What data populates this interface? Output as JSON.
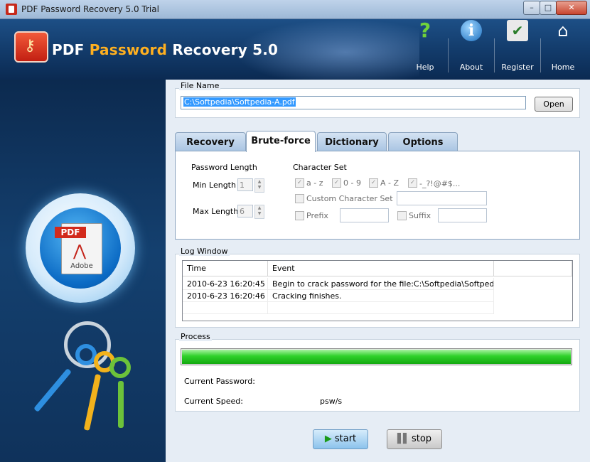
{
  "window": {
    "title": "PDF Password Recovery 5.0 Trial",
    "min": "–",
    "max": "□",
    "close": "✕"
  },
  "header": {
    "logo_text_1": "PDF",
    "logo_text_2": "Password",
    "logo_text_3": "Recovery 5.0",
    "nav": [
      {
        "label": "Help",
        "icon": "help-icon"
      },
      {
        "label": "About",
        "icon": "info-icon"
      },
      {
        "label": "Register",
        "icon": "register-icon"
      },
      {
        "label": "Home",
        "icon": "home-icon"
      }
    ]
  },
  "sidebar_art": {
    "pdf_tag": "PDF",
    "pdf_caption": "Adobe"
  },
  "file": {
    "group_label": "File Name",
    "path": "C:\\Softpedia\\Softpedia-A.pdf",
    "open_label": "Open"
  },
  "tabs": [
    {
      "label": "Recovery",
      "active": false
    },
    {
      "label": "Brute-force",
      "active": true
    },
    {
      "label": "Dictionary",
      "active": false
    },
    {
      "label": "Options",
      "active": false
    }
  ],
  "bruteforce": {
    "password_length_label": "Password Length",
    "min_label": "Min Length",
    "min_value": "1",
    "max_label": "Max Length",
    "max_value": "6",
    "charset_label": "Character Set",
    "charset_options": [
      {
        "label": "a - z",
        "checked": true
      },
      {
        "label": "0 - 9",
        "checked": true
      },
      {
        "label": "A - Z",
        "checked": true
      },
      {
        "label": "-_?!@#$...",
        "checked": true
      }
    ],
    "custom_label": "Custom Character Set",
    "custom_checked": false,
    "prefix_label": "Prefix",
    "prefix_checked": false,
    "suffix_label": "Suffix",
    "suffix_checked": false
  },
  "log": {
    "group_label": "Log Window",
    "columns": [
      "Time",
      "Event"
    ],
    "rows": [
      {
        "time": "2010-6-23 16:20:45",
        "event": "Begin to crack password for the file:C:\\Softpedia\\Softpedia-..."
      },
      {
        "time": "2010-6-23 16:20:46",
        "event": "Cracking finishes."
      }
    ]
  },
  "process": {
    "group_label": "Process",
    "progress": 1.0,
    "current_password_label": "Current Password:",
    "current_password_value": "",
    "current_speed_label": "Current Speed:",
    "current_speed_unit": "psw/s"
  },
  "actions": {
    "start_label": "start",
    "stop_label": "stop"
  }
}
